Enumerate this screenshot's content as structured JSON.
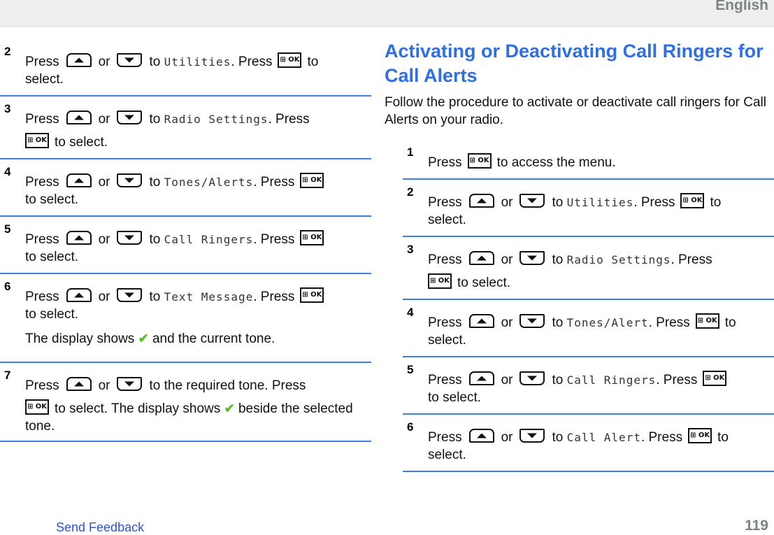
{
  "header": {
    "language": "English"
  },
  "left_steps": [
    {
      "num": "2",
      "lines": [
        {
          "pre": "Press",
          "up": true,
          "or": "or",
          "down": true,
          "to": "to",
          "target": "Utilities",
          "post": ". Press",
          "ok": true,
          "after": "to",
          "tail": "select."
        }
      ]
    },
    {
      "num": "3",
      "lines": [
        {
          "pre": "Press",
          "up": true,
          "or": "or",
          "down": true,
          "to": "to",
          "target": "Radio Settings",
          "post": ". Press",
          "tail_ok": true,
          "tail": "to select."
        }
      ]
    },
    {
      "num": "4",
      "lines": [
        {
          "pre": "Press",
          "up": true,
          "or": "or",
          "down": true,
          "to": "to",
          "target": "Tones/Alerts",
          "post": ". Press",
          "ok": true,
          "tail": "to select."
        }
      ]
    },
    {
      "num": "5",
      "lines": [
        {
          "pre": "Press",
          "up": true,
          "or": "or",
          "down": true,
          "to": "to",
          "target": "Call Ringers",
          "post": ". Press",
          "ok": true,
          "tail": "to select."
        }
      ]
    },
    {
      "num": "6",
      "lines": [
        {
          "pre": "Press",
          "up": true,
          "or": "or",
          "down": true,
          "to": "to",
          "target": "Text Message",
          "post": ". Press",
          "ok": true,
          "tail": "to select."
        }
      ],
      "extra": {
        "pre": "The display shows",
        "post": "and the current tone."
      }
    },
    {
      "num": "7",
      "lines": [
        {
          "pre": "Press",
          "up": true,
          "or": "or",
          "down": true,
          "to": "to the required tone. Press",
          "tail_ok": true,
          "tail": "to select. The display shows",
          "check_after": "beside the selected tone."
        }
      ]
    }
  ],
  "section": {
    "title": "Activating or Deactivating Call Ringers for Call Alerts",
    "intro": "Follow the procedure to activate or deactivate call ringers for Call Alerts on your radio."
  },
  "right_steps": [
    {
      "num": "1",
      "text_pre": "Press",
      "text_post": "to access the menu."
    },
    {
      "num": "2",
      "pre": "Press",
      "or": "or",
      "to": "to",
      "target": "Utilities",
      "post": ". Press",
      "after": "to",
      "tail": "select."
    },
    {
      "num": "3",
      "pre": "Press",
      "or": "or",
      "to": "to",
      "target": "Radio Settings",
      "post": ". Press",
      "tail": "to select."
    },
    {
      "num": "4",
      "pre": "Press",
      "or": "or",
      "to": "to",
      "target": "Tones/Alert",
      "post": ". Press",
      "after": "to",
      "tail": "select."
    },
    {
      "num": "5",
      "pre": "Press",
      "or": "or",
      "to": "to",
      "target": "Call Ringers",
      "post": ". Press",
      "tail": "to select."
    },
    {
      "num": "6",
      "pre": "Press",
      "or": "or",
      "to": "to",
      "target": "Call Alert",
      "post": ". Press",
      "after": "to",
      "tail": "select."
    }
  ],
  "keys": {
    "up": "up-arrow-key",
    "down": "down-arrow-key",
    "ok_label": "⊞ OK",
    "check": "✔"
  },
  "footer": {
    "link": "Send Feedback",
    "page": "119"
  },
  "colors": {
    "accent": "#2f6fe4",
    "rule": "#3d7fe0",
    "check": "#55c02a",
    "header_bg": "#eeeeec"
  }
}
